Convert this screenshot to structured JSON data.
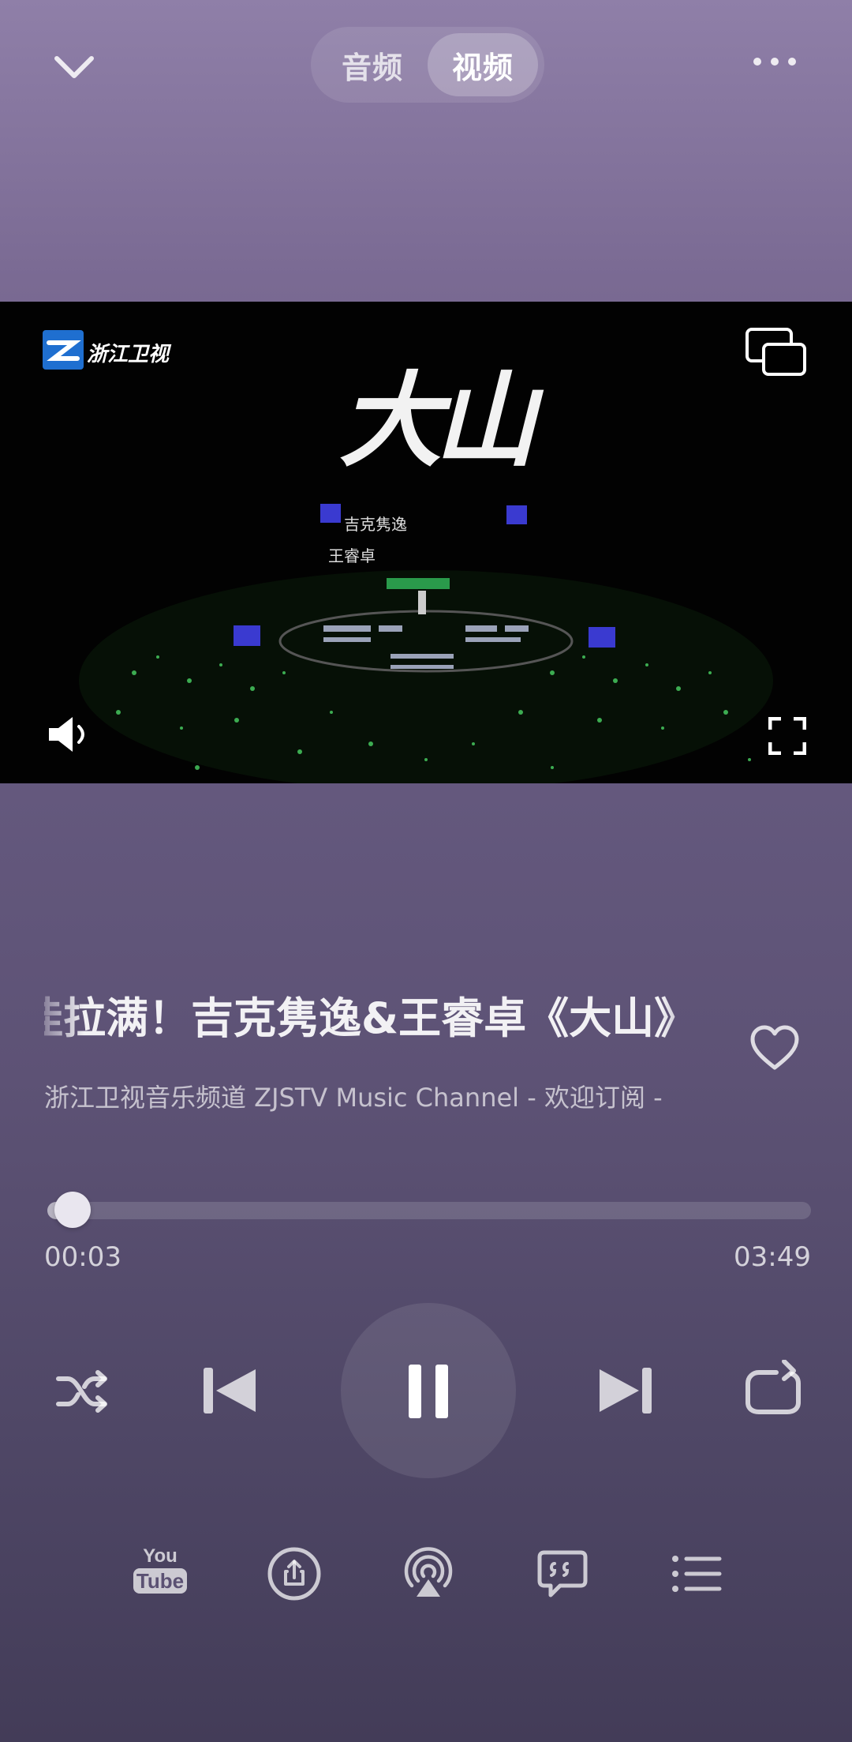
{
  "top_bar": {
    "tabs": [
      {
        "label": "音频",
        "selected": false
      },
      {
        "label": "视频",
        "selected": true
      }
    ]
  },
  "video": {
    "channel_logo_text": "浙江卫视",
    "poster_title": "大山",
    "poster_credits": [
      "吉克隽逸",
      "王睿卓"
    ]
  },
  "track": {
    "title": "佳拉满！吉克隽逸&王睿卓《大山》",
    "artist": "浙江卫视音乐频道 ZJSTV Music Channel - 欢迎订阅 -",
    "liked": false
  },
  "progress": {
    "elapsed": "00:03",
    "total": "03:49",
    "fraction": 0.013
  },
  "controls": {
    "state": "playing",
    "icons": [
      "shuffle-icon",
      "previous-icon",
      "pause-icon",
      "next-icon",
      "repeat-icon"
    ]
  },
  "bottom_actions": {
    "youtube": {
      "you": "You",
      "tube": "Tube"
    },
    "icons": [
      "youtube-icon",
      "share-icon",
      "airplay-icon",
      "lyrics-icon",
      "queue-icon"
    ]
  },
  "colors": {
    "background_top": "#8f7fa8",
    "background_bottom": "#433c58",
    "accent": "#e9e6ef"
  }
}
